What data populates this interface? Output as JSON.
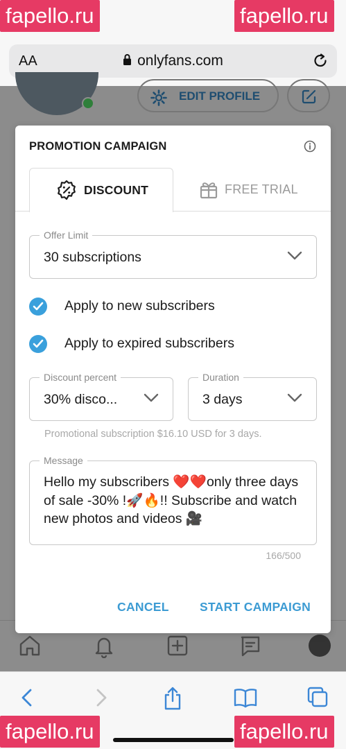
{
  "browser": {
    "text_size_label": "AA",
    "domain": "onlyfans.com"
  },
  "background_page": {
    "edit_profile_label": "EDIT PROFILE"
  },
  "modal": {
    "title": "PROMOTION CAMPAIGN",
    "tabs": [
      {
        "label": "DISCOUNT",
        "selected": true,
        "icon": "discount-badge-icon"
      },
      {
        "label": "FREE TRIAL",
        "selected": false,
        "icon": "gift-icon"
      }
    ],
    "offer_limit": {
      "label": "Offer Limit",
      "value": "30 subscriptions"
    },
    "checkboxes": [
      {
        "label": "Apply to new subscribers",
        "checked": true
      },
      {
        "label": "Apply to expired subscribers",
        "checked": true
      }
    ],
    "discount_percent": {
      "label": "Discount percent",
      "value": "30% disco..."
    },
    "duration": {
      "label": "Duration",
      "value": "3 days"
    },
    "promo_note": "Promotional subscription $16.10 USD for 3 days.",
    "message": {
      "label": "Message",
      "value": "Hello my subscribers ❤️❤️only three days of sale -30% !🚀🔥!! Subscribe and watch new photos and videos 🎥"
    },
    "char_counter": "166/500",
    "cancel_label": "CANCEL",
    "start_label": "START CAMPAIGN"
  },
  "watermarks": [
    "fapello.ru",
    "fapello.ru",
    "fapello.ru",
    "fapello.ru"
  ],
  "colors": {
    "accent": "#3c9bd3",
    "checkbox": "#3aa0dc",
    "watermark": "#e63a64",
    "online_dot": "#2f7f3a"
  }
}
